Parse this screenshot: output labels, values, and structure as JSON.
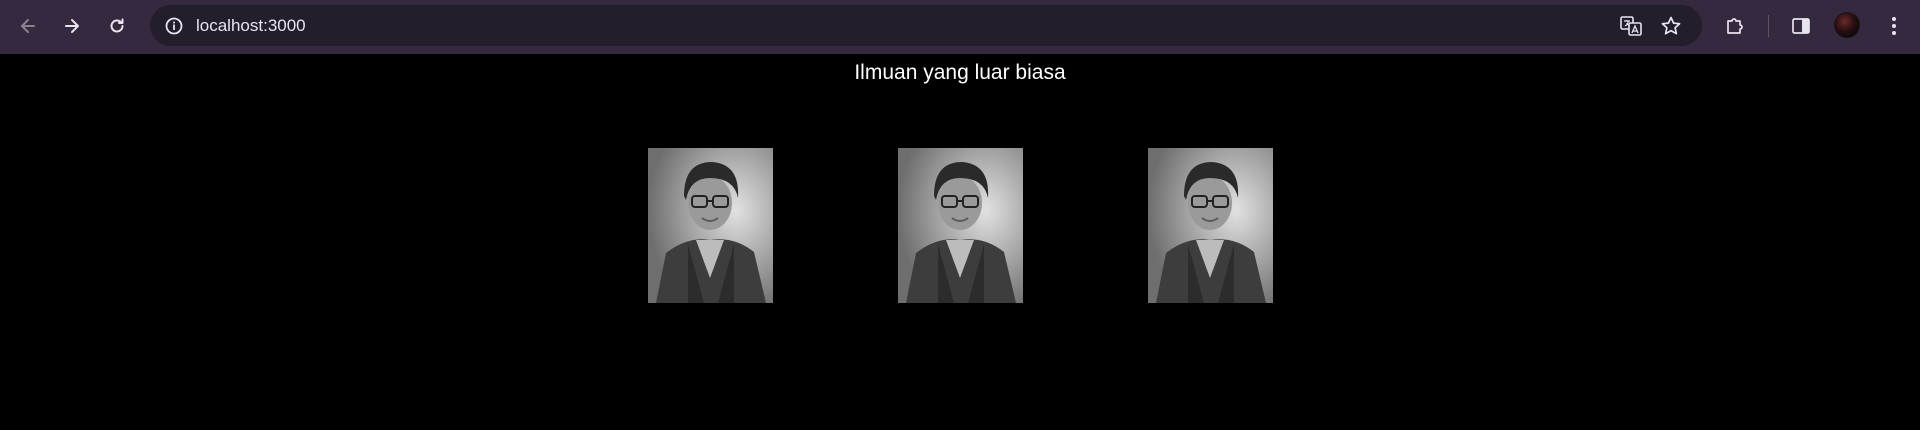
{
  "browser": {
    "url": "localhost:3000",
    "icons": [
      "back-icon",
      "forward-icon",
      "reload-icon",
      "site-info-icon",
      "translate-icon",
      "bookmark-star-icon",
      "extensions-icon",
      "side-panel-icon",
      "profile-avatar",
      "more-menu-icon"
    ],
    "colors": {
      "toolbar": "#35293f",
      "omnibox": "#241d2b"
    }
  },
  "page": {
    "title": "Ilmuan yang luar biasa",
    "background": "#000000",
    "text_color": "#ffffff",
    "gallery": [
      {
        "kind": "portrait-photo",
        "tone": "grayscale"
      },
      {
        "kind": "portrait-photo",
        "tone": "grayscale"
      },
      {
        "kind": "portrait-photo",
        "tone": "grayscale"
      }
    ]
  }
}
